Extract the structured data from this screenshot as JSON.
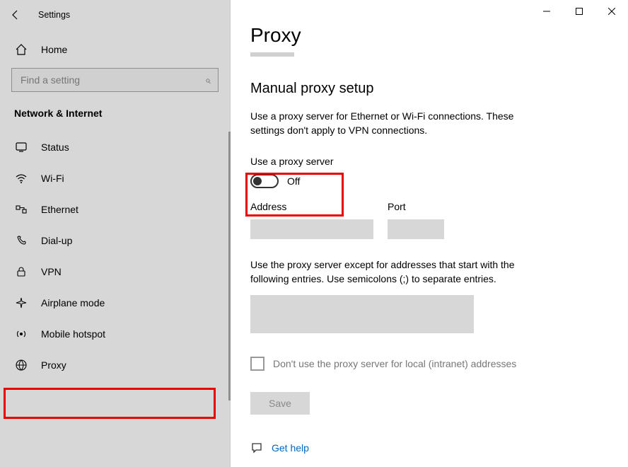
{
  "window": {
    "title": "Settings"
  },
  "sidebar": {
    "home": "Home",
    "search_placeholder": "Find a setting",
    "category": "Network & Internet",
    "items": [
      {
        "label": "Status"
      },
      {
        "label": "Wi-Fi"
      },
      {
        "label": "Ethernet"
      },
      {
        "label": "Dial-up"
      },
      {
        "label": "VPN"
      },
      {
        "label": "Airplane mode"
      },
      {
        "label": "Mobile hotspot"
      },
      {
        "label": "Proxy"
      }
    ]
  },
  "main": {
    "title": "Proxy",
    "section": "Manual proxy setup",
    "section_desc": "Use a proxy server for Ethernet or Wi-Fi connections. These settings don't apply to VPN connections.",
    "toggle_label": "Use a proxy server",
    "toggle_state": "Off",
    "address_label": "Address",
    "port_label": "Port",
    "exceptions_desc": "Use the proxy server except for addresses that start with the following entries. Use semicolons (;) to separate entries.",
    "local_bypass_label": "Don't use the proxy server for local (intranet) addresses",
    "save_label": "Save",
    "help_label": "Get help"
  }
}
